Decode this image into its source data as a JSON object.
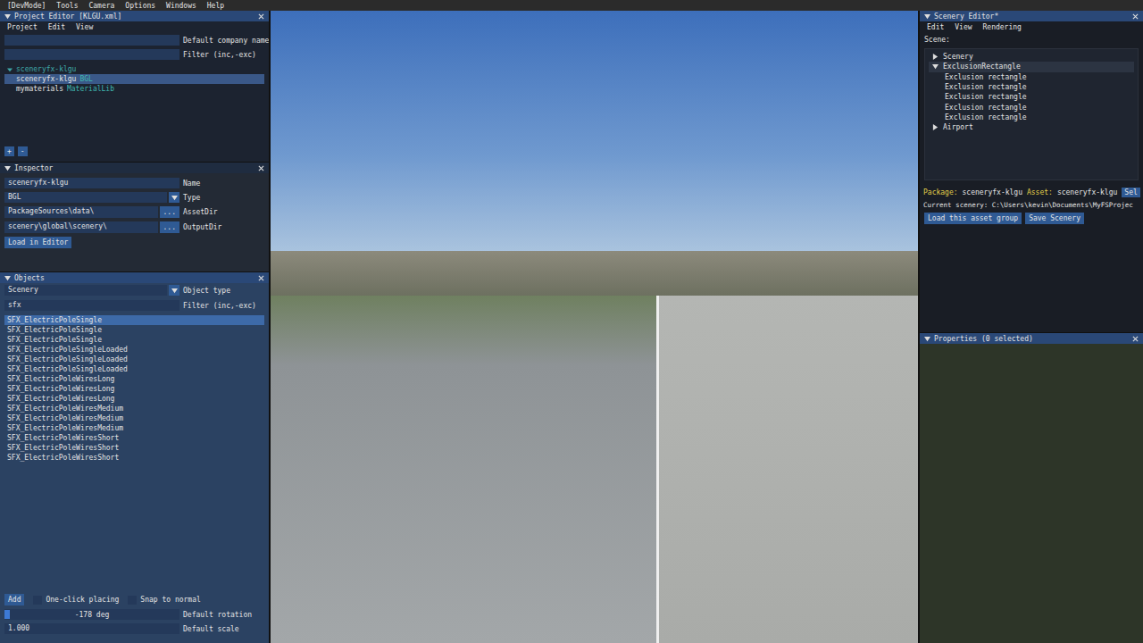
{
  "menu_bar": [
    "[DevMode]",
    "Tools",
    "Camera",
    "Options",
    "Windows",
    "Help"
  ],
  "project_editor": {
    "title": "Project Editor [KLGU.xml]",
    "menu": [
      "Project",
      "Edit",
      "View"
    ],
    "fields": [
      {
        "label": "Default company name",
        "value": ""
      },
      {
        "label": "Filter (inc,-exc)",
        "value": ""
      }
    ],
    "tree": [
      {
        "kind": "group",
        "name": "sceneryfx-klgu",
        "tag": "",
        "expanded": true,
        "selected": false
      },
      {
        "kind": "item",
        "name": "sceneryfx-klgu",
        "tag": "BGL",
        "expanded": false,
        "selected": true
      },
      {
        "kind": "item",
        "name": "mymaterials",
        "tag": "MaterialLib",
        "expanded": false,
        "selected": false
      }
    ],
    "buttons": [
      "+",
      "-"
    ]
  },
  "inspector": {
    "title": "Inspector",
    "rows": [
      {
        "kind": "text",
        "value": "sceneryfx-klgu",
        "button": "",
        "label": "Name"
      },
      {
        "kind": "dropdown",
        "value": "BGL",
        "button": "",
        "label": "Type"
      },
      {
        "kind": "path",
        "value": "PackageSources\\data\\",
        "button": "...",
        "label": "AssetDir"
      },
      {
        "kind": "path",
        "value": "scenery\\global\\scenery\\",
        "button": "...",
        "label": "OutputDir"
      }
    ],
    "button": "Load in Editor"
  },
  "objects": {
    "title": "Objects",
    "type": {
      "value": "Scenery",
      "label": "Object type"
    },
    "filter": {
      "value": "sfx",
      "label": "Filter (inc,-exc)"
    },
    "items": [
      {
        "name": "SFX_ElectricPoleSingle",
        "selected": true
      },
      {
        "name": "SFX_ElectricPoleSingle",
        "selected": false
      },
      {
        "name": "SFX_ElectricPoleSingle",
        "selected": false
      },
      {
        "name": "SFX_ElectricPoleSingleLoaded",
        "selected": false
      },
      {
        "name": "SFX_ElectricPoleSingleLoaded",
        "selected": false
      },
      {
        "name": "SFX_ElectricPoleSingleLoaded",
        "selected": false
      },
      {
        "name": "SFX_ElectricPoleWiresLong",
        "selected": false
      },
      {
        "name": "SFX_ElectricPoleWiresLong",
        "selected": false
      },
      {
        "name": "SFX_ElectricPoleWiresLong",
        "selected": false
      },
      {
        "name": "SFX_ElectricPoleWiresMedium",
        "selected": false
      },
      {
        "name": "SFX_ElectricPoleWiresMedium",
        "selected": false
      },
      {
        "name": "SFX_ElectricPoleWiresMedium",
        "selected": false
      },
      {
        "name": "SFX_ElectricPoleWiresShort",
        "selected": false
      },
      {
        "name": "SFX_ElectricPoleWiresShort",
        "selected": false
      },
      {
        "name": "SFX_ElectricPoleWiresShort",
        "selected": false
      }
    ],
    "add": "Add",
    "checkboxes": [
      {
        "label": "One-click placing",
        "checked": false
      },
      {
        "label": "Snap to normal",
        "checked": false
      }
    ],
    "rotation": {
      "value": "-178 deg",
      "label": "Default rotation",
      "level": 0.03
    },
    "scale": {
      "value": "1.000",
      "label": "Default scale"
    }
  },
  "scenery_editor": {
    "title": "Scenery Editor*",
    "menu": [
      "Edit",
      "View",
      "Rendering"
    ],
    "scene_label": "Scene:",
    "tree": [
      {
        "name": "Scenery",
        "depth": 0,
        "expanded": false,
        "selected": false
      },
      {
        "name": "ExclusionRectangle",
        "depth": 0,
        "expanded": true,
        "selected": true
      },
      {
        "name": "Exclusion rectangle",
        "depth": 1,
        "expanded": false,
        "selected": false
      },
      {
        "name": "Exclusion rectangle",
        "depth": 1,
        "expanded": false,
        "selected": false
      },
      {
        "name": "Exclusion rectangle",
        "depth": 1,
        "expanded": false,
        "selected": false
      },
      {
        "name": "Exclusion rectangle",
        "depth": 1,
        "expanded": false,
        "selected": false
      },
      {
        "name": "Exclusion rectangle",
        "depth": 1,
        "expanded": false,
        "selected": false
      },
      {
        "name": "Airport",
        "depth": 0,
        "expanded": false,
        "selected": false
      }
    ],
    "package_label": "Package:",
    "package": "sceneryfx-klgu",
    "asset_label": "Asset:",
    "asset": "sceneryfx-klgu",
    "select_button": "Sel",
    "current_scenery": "Current scenery: C:\\Users\\kevin\\Documents\\MyFSProjec",
    "buttons": [
      "Load this asset group",
      "Save Scenery"
    ]
  },
  "properties": {
    "title": "Properties (0 selected)"
  }
}
